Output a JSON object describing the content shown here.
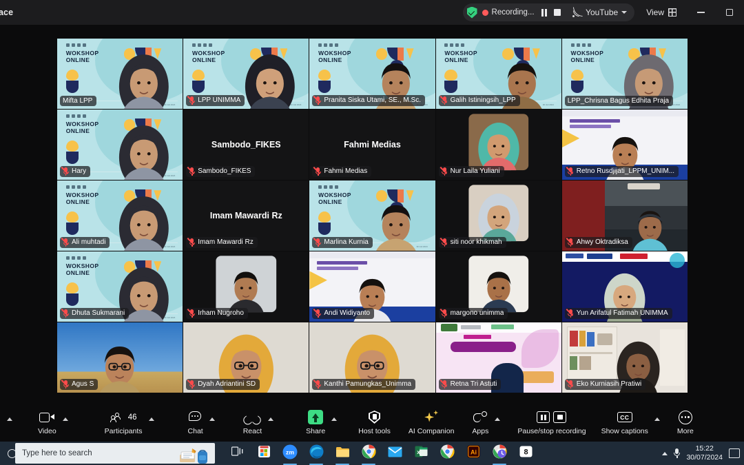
{
  "window": {
    "title": "ace",
    "recording_label": "Recording...",
    "youtube_label": "YouTube",
    "view_label": "View",
    "minimize_label": "Minimize",
    "maximize_label": "Maximize",
    "active_speaker_border_color": "#43e08f"
  },
  "gallery": {
    "virtual_bg_text_line1": "WOKSHOP",
    "virtual_bg_text_line2": "ONLINE",
    "tiles": [
      {
        "name": "Mifta LPP",
        "kind": "video-ws",
        "muted": false,
        "active": false
      },
      {
        "name": "LPP UNIMMA",
        "kind": "video-ws",
        "muted": true,
        "active": false
      },
      {
        "name": "Pranita Siska Utami, SE., M.Sc.",
        "kind": "video-ws",
        "muted": true,
        "active": false
      },
      {
        "name": "Galih Istiningsih_LPP",
        "kind": "video-ws",
        "muted": true,
        "active": false
      },
      {
        "name": "LPP_Chrisna Bagus Edhita Praja",
        "kind": "video-ws",
        "muted": false,
        "active": true
      },
      {
        "name": "Hary",
        "kind": "video-ws",
        "muted": true,
        "active": false
      },
      {
        "name": "Sambodo_FIKES",
        "kind": "name-only",
        "muted": true,
        "active": false
      },
      {
        "name": "Fahmi Medias",
        "kind": "name-only",
        "muted": true,
        "active": false
      },
      {
        "name": "Nur Laila Yuliani",
        "kind": "thumb-photo",
        "muted": true,
        "active": false
      },
      {
        "name": "Retno Rusdjijati_LPPM_UNIM...",
        "kind": "video-slide",
        "muted": true,
        "active": false
      },
      {
        "name": "Ali muhtadi",
        "kind": "video-ws",
        "muted": true,
        "active": false
      },
      {
        "name": "Imam Mawardi Rz",
        "kind": "name-only",
        "muted": true,
        "active": false
      },
      {
        "name": "Marlina Kurnia",
        "kind": "video-ws",
        "muted": true,
        "active": false
      },
      {
        "name": "siti noor khikmah",
        "kind": "thumb-photo",
        "muted": true,
        "active": false
      },
      {
        "name": "Ahwy Oktradiksa",
        "kind": "video-car",
        "muted": true,
        "active": false
      },
      {
        "name": "Dhuta Sukmarani",
        "kind": "video-ws",
        "muted": true,
        "active": false
      },
      {
        "name": "Irham Nugroho",
        "kind": "thumb-photo",
        "muted": true,
        "active": false
      },
      {
        "name": "Andi Widiyanto",
        "kind": "video-slide",
        "muted": true,
        "active": false
      },
      {
        "name": "margono unimma",
        "kind": "thumb-photo",
        "muted": true,
        "active": false
      },
      {
        "name": "Yun Arifatul Fatimah UNIMMA",
        "kind": "video-slide-blue",
        "muted": true,
        "active": false
      },
      {
        "name": "Agus S",
        "kind": "video-sky",
        "muted": true,
        "active": false
      },
      {
        "name": "Dyah Adriantini SD",
        "kind": "video-plain",
        "muted": true,
        "active": false
      },
      {
        "name": "Kanthi Pamungkas_Unimma",
        "kind": "video-plain",
        "muted": true,
        "active": false
      },
      {
        "name": "Retna Tri Astuti",
        "kind": "video-webinar",
        "muted": true,
        "active": false
      },
      {
        "name": "Eko Kurniasih Pratiwi",
        "kind": "video-shelf",
        "muted": true,
        "active": false
      }
    ]
  },
  "controls": {
    "items": [
      {
        "label": "Video",
        "icon": "video-camera-icon",
        "caret": true,
        "badge": ""
      },
      {
        "label": "Participants",
        "icon": "participants-icon",
        "caret": true,
        "badge": "46"
      },
      {
        "label": "Chat",
        "icon": "chat-bubble-icon",
        "caret": true,
        "badge": ""
      },
      {
        "label": "React",
        "icon": "heart-icon",
        "caret": true,
        "badge": ""
      },
      {
        "label": "Share",
        "icon": "share-screen-icon",
        "caret": true,
        "badge": ""
      },
      {
        "label": "Host tools",
        "icon": "shield-icon",
        "caret": false,
        "badge": ""
      },
      {
        "label": "AI Companion",
        "icon": "sparkle-icon",
        "caret": false,
        "badge": ""
      },
      {
        "label": "Apps",
        "icon": "apps-icon",
        "caret": true,
        "badge": ""
      },
      {
        "label": "Pause/stop recording",
        "icon": "pause-stop-recording-icon",
        "caret": false,
        "badge": ""
      },
      {
        "label": "Show captions",
        "icon": "closed-captions-icon",
        "caret": true,
        "badge": ""
      },
      {
        "label": "More",
        "icon": "more-ellipsis-icon",
        "caret": false,
        "badge": ""
      }
    ],
    "leading_caret_label": "Audio options",
    "share_accent_color": "#3ddc84"
  },
  "taskbar": {
    "search_placeholder": "Type here to search",
    "apps": [
      {
        "name": "task-view-icon",
        "glyph": ""
      },
      {
        "name": "microsoft-store-icon",
        "glyph": ""
      },
      {
        "name": "zoom-icon",
        "glyph": "zm"
      },
      {
        "name": "microsoft-edge-icon",
        "glyph": ""
      },
      {
        "name": "file-explorer-icon",
        "glyph": ""
      },
      {
        "name": "chrome-icon",
        "glyph": ""
      },
      {
        "name": "mail-icon",
        "glyph": ""
      },
      {
        "name": "excel-icon",
        "glyph": "x"
      },
      {
        "name": "chrome-alt-icon",
        "glyph": ""
      },
      {
        "name": "adobe-illustrator-icon",
        "glyph": "Ai"
      },
      {
        "name": "chrome-history-icon",
        "glyph": ""
      },
      {
        "name": "capcut-icon",
        "glyph": "8"
      }
    ],
    "time": "15:22",
    "date": "30/07/2024"
  }
}
